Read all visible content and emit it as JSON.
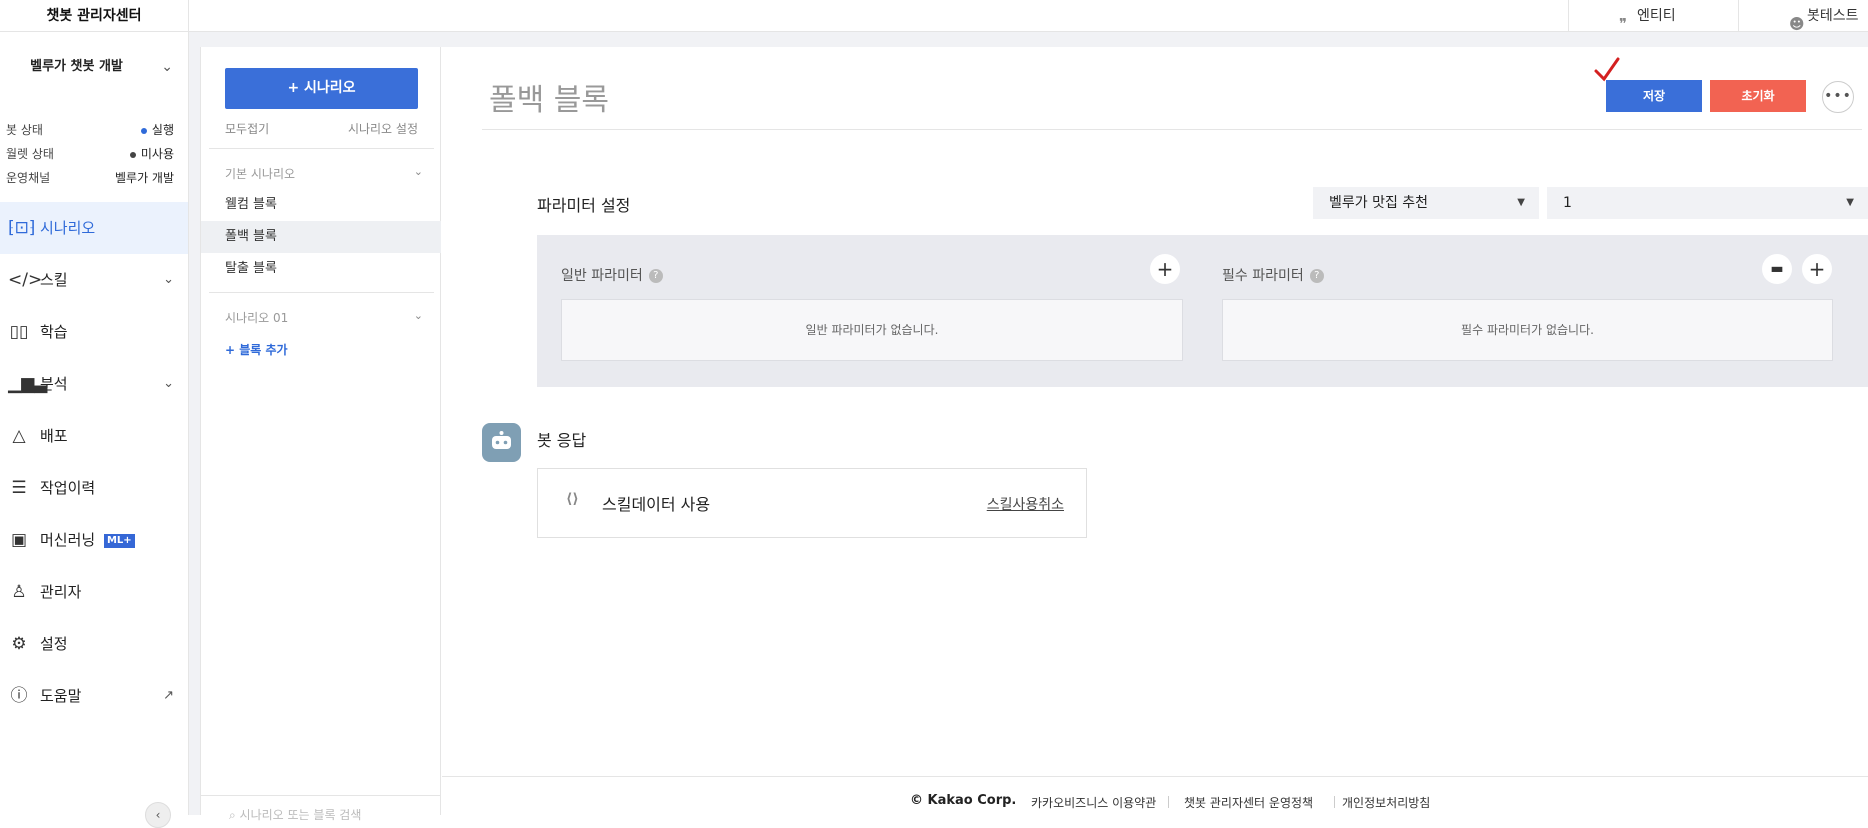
{
  "app": {
    "title": "챗봇 관리자센터"
  },
  "header": {
    "links": [
      {
        "label": "엔티티",
        "icon": "quote-icon"
      },
      {
        "label": "봇테스트",
        "icon": "chat-icon"
      }
    ]
  },
  "sidebar": {
    "bot_name": "벨루가 챗봇 개발",
    "status": [
      {
        "label": "봇 상태",
        "value": "실행",
        "dot_color": "#2f6ad9"
      },
      {
        "label": "월렛 상태",
        "value": "미사용",
        "dot_color": "#444444"
      },
      {
        "label": "운영채널",
        "value": "벨루가 개발"
      }
    ],
    "nav": [
      {
        "label": "시나리오",
        "icon": "scenario-icon",
        "active": true
      },
      {
        "label": "스킬",
        "icon": "code-icon",
        "expandable": true
      },
      {
        "label": "학습",
        "icon": "book-icon"
      },
      {
        "label": "분석",
        "icon": "chart-icon",
        "expandable": true
      },
      {
        "label": "배포",
        "icon": "deploy-icon"
      },
      {
        "label": "작업이력",
        "icon": "history-icon"
      },
      {
        "label": "머신러닝",
        "icon": "chip-icon",
        "badge": "ML+"
      },
      {
        "label": "관리자",
        "icon": "admin-icon"
      },
      {
        "label": "설정",
        "icon": "gear-icon"
      },
      {
        "label": "도움말",
        "icon": "help-icon",
        "external": true
      }
    ]
  },
  "scenario_panel": {
    "add_button": "+ 시나리오",
    "collapse_all": "모두접기",
    "scenario_settings": "시나리오 설정",
    "groups": [
      {
        "name": "기본 시나리오",
        "blocks": [
          "웰컴 블록",
          "폴백 블록",
          "탈출 블록"
        ],
        "selected": "폴백 블록"
      },
      {
        "name": "시나리오 01",
        "blocks": []
      }
    ],
    "add_block": "+ 블록 추가",
    "search_placeholder": "시나리오 또는 블록 검색"
  },
  "main": {
    "title": "폴백 블록",
    "save": "저장",
    "reset": "초기화",
    "more": "•••",
    "param_settings": "파라미터 설정",
    "select_bot": "벨루가 맛집 추천",
    "select_num": "1",
    "general_params": "일반 파라미터",
    "required_params": "필수 파라미터",
    "general_empty": "일반 파라미터가 없습니다.",
    "required_empty": "필수 파라미터가 없습니다.",
    "bot_response": "봇 응답",
    "skill_data": "스킬데이터 사용",
    "skill_cancel": "스킬사용취소"
  },
  "footer": {
    "copyright": "© Kakao Corp.",
    "links": [
      "카카오비즈니스 이용약관",
      "챗봇 관리자센터 운영정책",
      "개인정보처리방침"
    ]
  },
  "colors": {
    "accent": "#3a6fd9",
    "danger": "#f26352",
    "panel": "#e9eaef"
  }
}
